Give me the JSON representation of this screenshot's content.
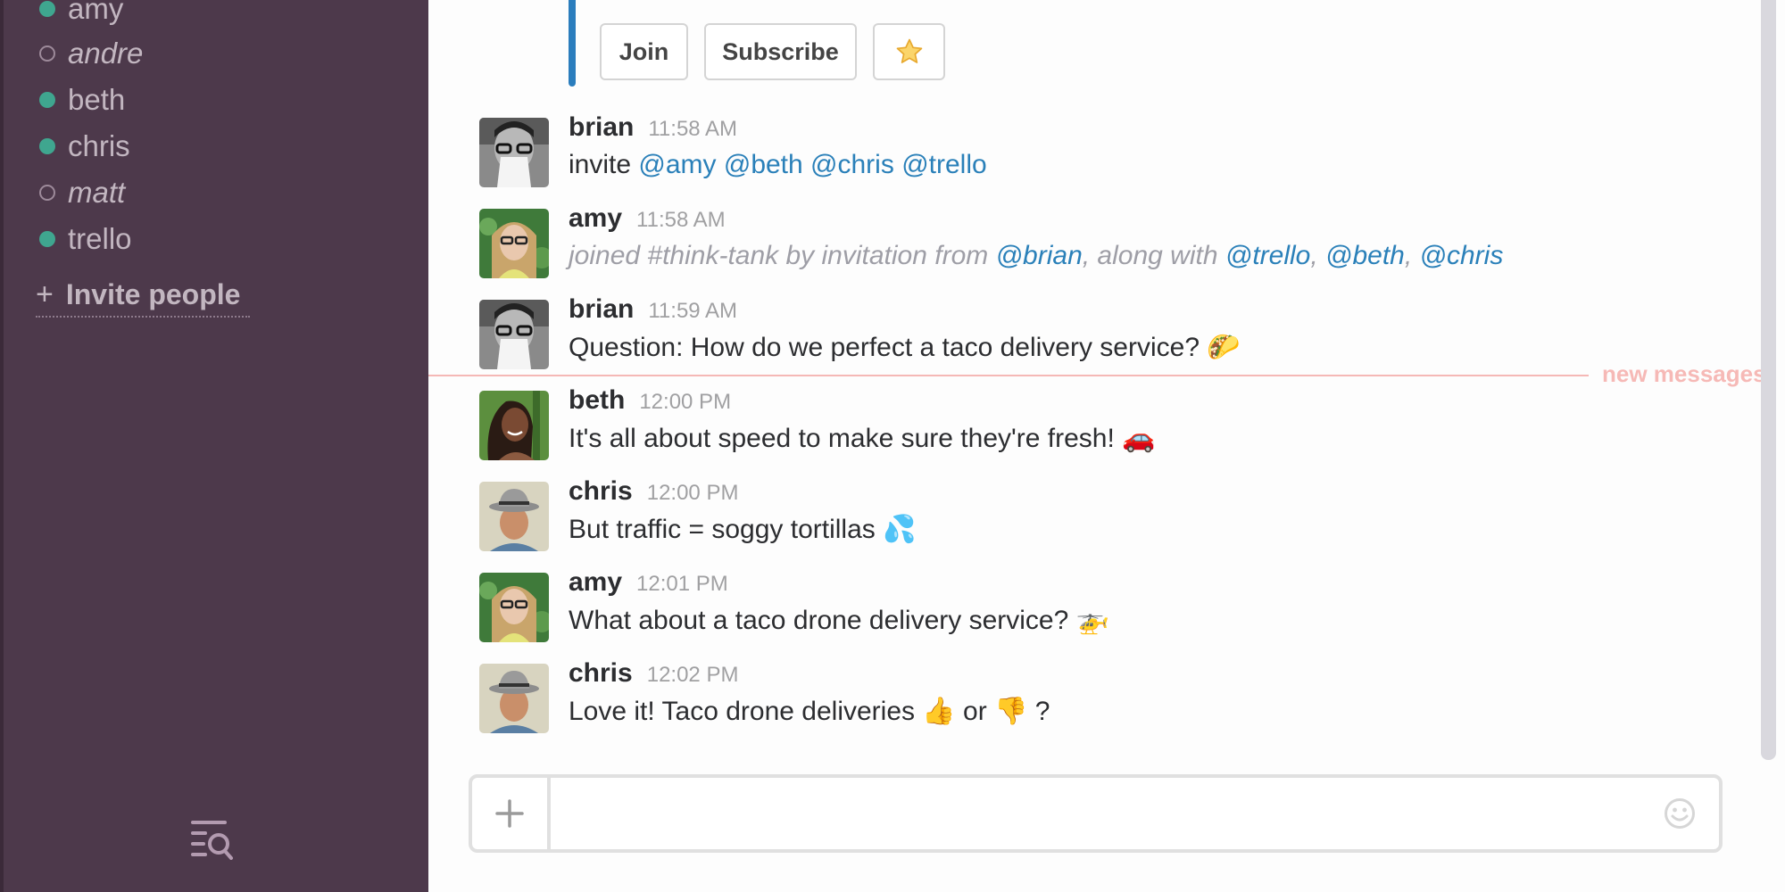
{
  "sidebar": {
    "direct_messages": [
      {
        "name": "amy",
        "status": "active"
      },
      {
        "name": "andre",
        "status": "away"
      },
      {
        "name": "beth",
        "status": "active"
      },
      {
        "name": "chris",
        "status": "active"
      },
      {
        "name": "matt",
        "status": "away"
      },
      {
        "name": "trello",
        "status": "active"
      }
    ],
    "invite_plus": "+",
    "invite_label": "Invite people",
    "search_icon": "list-search-icon"
  },
  "attachment": {
    "join_label": "Join",
    "subscribe_label": "Subscribe",
    "star_glyph": "☆",
    "bar_color": "#2b7dbd"
  },
  "messages": [
    {
      "author": "brian",
      "time": "11:58 AM",
      "avatar": "brian",
      "parts": [
        {
          "t": "text",
          "v": "invite "
        },
        {
          "t": "mention",
          "v": "@amy"
        },
        {
          "t": "text",
          "v": " "
        },
        {
          "t": "mention",
          "v": "@beth"
        },
        {
          "t": "text",
          "v": " "
        },
        {
          "t": "mention",
          "v": "@chris"
        },
        {
          "t": "text",
          "v": " "
        },
        {
          "t": "mention",
          "v": "@trello"
        }
      ]
    },
    {
      "author": "amy",
      "time": "11:58 AM",
      "avatar": "amy",
      "system": true,
      "parts": [
        {
          "t": "text",
          "v": "joined #think-tank by invitation from "
        },
        {
          "t": "mention",
          "v": "@brian"
        },
        {
          "t": "text",
          "v": ", along with "
        },
        {
          "t": "mention",
          "v": "@trello"
        },
        {
          "t": "text",
          "v": ", "
        },
        {
          "t": "mention",
          "v": "@beth"
        },
        {
          "t": "text",
          "v": ", "
        },
        {
          "t": "mention",
          "v": "@chris"
        }
      ]
    },
    {
      "author": "brian",
      "time": "11:59 AM",
      "avatar": "brian",
      "parts": [
        {
          "t": "text",
          "v": "Question: How do we perfect a taco delivery service? "
        },
        {
          "t": "emoji",
          "v": "🌮",
          "name": "taco-emoji"
        }
      ]
    },
    {
      "author": "beth",
      "time": "12:00 PM",
      "avatar": "beth",
      "parts": [
        {
          "t": "text",
          "v": "It's all about speed to make sure they're fresh! "
        },
        {
          "t": "emoji",
          "v": "🚗",
          "name": "car-emoji"
        }
      ]
    },
    {
      "author": "chris",
      "time": "12:00 PM",
      "avatar": "chris",
      "parts": [
        {
          "t": "text",
          "v": "But traffic = soggy tortillas "
        },
        {
          "t": "emoji",
          "v": "💦",
          "name": "sweat-drops-emoji"
        }
      ]
    },
    {
      "author": "amy",
      "time": "12:01 PM",
      "avatar": "amy",
      "parts": [
        {
          "t": "text",
          "v": "What about a taco drone delivery service? "
        },
        {
          "t": "emoji",
          "v": "🚁",
          "name": "helicopter-emoji"
        }
      ]
    },
    {
      "author": "chris",
      "time": "12:02 PM",
      "avatar": "chris",
      "parts": [
        {
          "t": "text",
          "v": "Love it! Taco drone deliveries "
        },
        {
          "t": "emoji",
          "v": "👍",
          "name": "thumbs-up-emoji"
        },
        {
          "t": "text",
          "v": "  or "
        },
        {
          "t": "emoji",
          "v": "👎",
          "name": "thumbs-down-emoji"
        },
        {
          "t": "text",
          "v": "  ?"
        }
      ]
    }
  ],
  "new_messages_label": "new messages",
  "colors": {
    "sidebar_bg": "#4d394b",
    "presence_active": "#3fa68f",
    "mention": "#2a80b9",
    "new_messages": "#f6b9b6"
  },
  "composer": {
    "plus_label": "+",
    "value": "",
    "placeholder": ""
  }
}
